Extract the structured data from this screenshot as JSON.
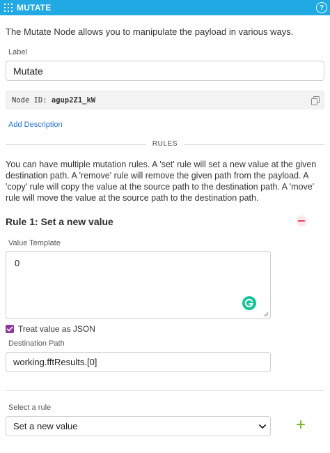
{
  "header": {
    "title": "MUTATE",
    "grid_icon": "grid-icon",
    "help_icon": "help-icon",
    "help_glyph": "?",
    "color": "#20a9e3"
  },
  "intro": "The Mutate Node allows you to manipulate the payload in various ways.",
  "label_field": {
    "label": "Label",
    "value": "Mutate"
  },
  "node_id": {
    "prefix": "Node ID:",
    "value": "agup2Z1_kW",
    "copy_icon": "copy-icon"
  },
  "add_description": "Add Description",
  "rules_section": {
    "heading": "RULES",
    "description": "You can have multiple mutation rules. A 'set' rule will set a new value at the given destination path. A 'remove' rule will remove the given path from the payload. A 'copy' rule will copy the value at the source path to the destination path. A 'move' rule will move the value at the source path to the destination path."
  },
  "rule1": {
    "title": "Rule 1: Set a new value",
    "value_template_label": "Value Template",
    "value_template": "0",
    "treat_as_json_label": "Treat value as JSON",
    "treat_as_json_checked": true,
    "destination_path_label": "Destination Path",
    "destination_path": "working.fftResults.[0]",
    "remove_color": "#e0445a"
  },
  "new_rule": {
    "label": "Select a rule",
    "selected": "Set a new value",
    "add_color": "#7ab829"
  },
  "accent": {
    "checkbox": "#8b3a9c",
    "link": "#1e6fc8",
    "grammarly": "#15c39a"
  }
}
